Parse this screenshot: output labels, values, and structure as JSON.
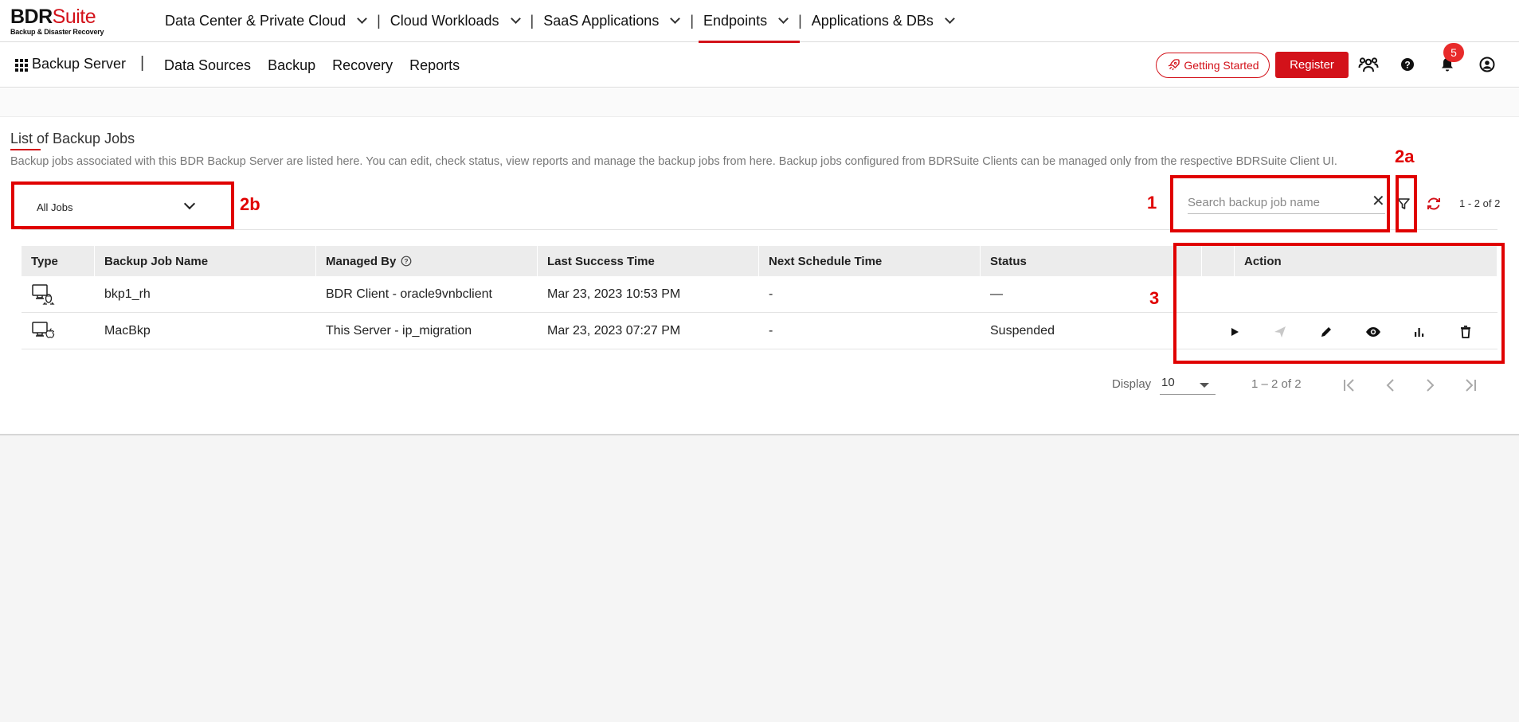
{
  "logo": {
    "part1": "BDR",
    "part2": "Suite",
    "subtitle": "Backup & Disaster Recovery"
  },
  "topnav": [
    {
      "label": "Data Center & Private Cloud"
    },
    {
      "label": "Cloud Workloads"
    },
    {
      "label": "SaaS Applications"
    },
    {
      "label": "Endpoints",
      "active": true
    },
    {
      "label": "Applications & DBs"
    }
  ],
  "subnav": {
    "title": "Backup Server",
    "items": [
      "Data Sources",
      "Backup",
      "Recovery",
      "Reports"
    ],
    "getting_started": "Getting Started",
    "register": "Register",
    "notification_count": "5"
  },
  "page": {
    "title": "List of Backup Jobs",
    "description": "Backup jobs associated with this BDR Backup Server are listed here. You can edit, check status, view reports and manage the backup jobs from here. Backup jobs configured from BDRSuite Clients can be managed only from the respective BDRSuite Client UI."
  },
  "filters": {
    "jobs_select": "All Jobs",
    "search_placeholder": "Search backup job name",
    "pagination_top": "1 - 2 of 2"
  },
  "table": {
    "headers": [
      "Type",
      "Backup Job Name",
      "Managed By",
      "Last Success Time",
      "Next Schedule Time",
      "Status",
      "",
      "Action"
    ],
    "rows": [
      {
        "type_icon": "linux-client-icon",
        "name": "bkp1_rh",
        "managed_by": "BDR Client - oracle9vnbclient",
        "last_success": "Mar 23, 2023 10:53 PM",
        "next_schedule": "-",
        "status": "—"
      },
      {
        "type_icon": "mac-client-icon",
        "name": "MacBkp",
        "managed_by": "This Server - ip_migration",
        "last_success": "Mar 23, 2023 07:27 PM",
        "next_schedule": "-",
        "status": "Suspended"
      }
    ]
  },
  "pagination": {
    "display_label": "Display",
    "page_size": "10",
    "range": "1 – 2 of 2"
  },
  "annotations": {
    "a1": "1",
    "a2a": "2a",
    "a2b": "2b",
    "a3": "3"
  },
  "colors": {
    "brand": "#d3121a",
    "annotation": "#e00000"
  }
}
